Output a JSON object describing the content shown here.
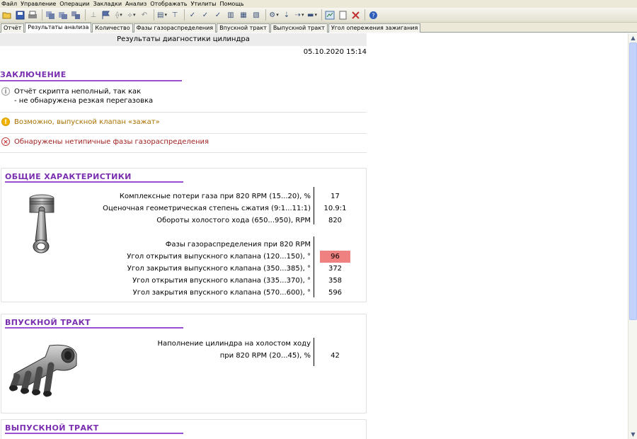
{
  "menu": [
    "Файл",
    "Управление",
    "Операции",
    "Закладки",
    "Анализ",
    "Отображать",
    "Утилиты",
    "Помощь"
  ],
  "tabs": [
    "Отчёт",
    "Результаты анализа",
    "Количество",
    "Фазы газораспределения",
    "Впускной тракт",
    "Выпускной тракт",
    "Угол опережения зажигания"
  ],
  "active_tab": "Результаты анализа",
  "report": {
    "title": "Результаты диагностики цилиндра",
    "datetime": "05.10.2020 15:14"
  },
  "conclusion": {
    "heading": "ЗАКЛЮЧЕНИЕ",
    "messages": [
      {
        "type": "info",
        "line1": "Отчёт скрипта неполный, так как",
        "line2": "- не обнаружена резкая перегазовка"
      },
      {
        "type": "warning",
        "line1": "Возможно, выпускной клапан «зажат»"
      },
      {
        "type": "error",
        "line1": "Обнаружены нетипичные фазы газораспределения"
      }
    ]
  },
  "general": {
    "heading": "ОБЩИЕ ХАРАКТЕРИСТИКИ",
    "rows": [
      {
        "label": "Комплексные потери газа при 820 RPM (15...20), %",
        "value": "17"
      },
      {
        "label": "Оценочная геометрическая степень сжатия (9:1...11:1)",
        "value": "10.9:1"
      },
      {
        "label": "Обороты холостого хода (650...950), RPM",
        "value": "820"
      },
      {
        "label": "Фазы газораспределения при 820 RPM",
        "value": ""
      },
      {
        "label": "Угол открытия выпускного клапана (120...150), °",
        "value": "96",
        "highlight": true
      },
      {
        "label": "Угол закрытия выпускного клапана (350...385), °",
        "value": "372"
      },
      {
        "label": "Угол открытия впускного клапана (335...370), °",
        "value": "358"
      },
      {
        "label": "Угол закрытия впускного клапана (570...600), °",
        "value": "596"
      }
    ]
  },
  "intake": {
    "heading": "ВПУСКНОЙ ТРАКТ",
    "rows": [
      {
        "label": "Наполнение цилиндра на холостом ходу",
        "value": ""
      },
      {
        "label": "при 820 RPM (20...45), %",
        "value": "42"
      }
    ]
  },
  "exhaust": {
    "heading": "ВЫПУСКНОЙ ТРАКТ"
  },
  "colors": {
    "heading": "#7a2fb0",
    "highlight": "#f08181",
    "warning_text": "#a87100",
    "error_text": "#a02020"
  }
}
